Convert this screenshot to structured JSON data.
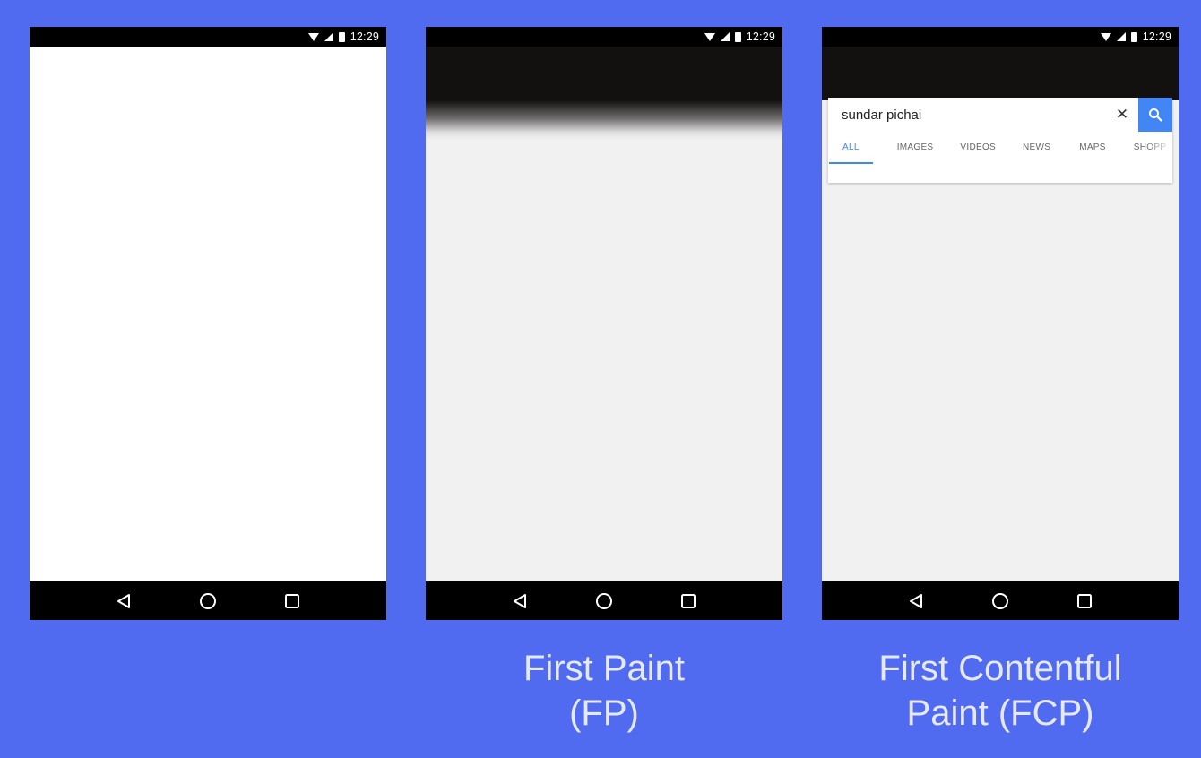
{
  "status_bar": {
    "time": "12:29"
  },
  "panels": [
    {
      "id": "blank"
    },
    {
      "id": "fp",
      "caption": {
        "line1": "First Paint",
        "line2": "(FP)"
      }
    },
    {
      "id": "fcp",
      "caption": {
        "line1": "First Contentful",
        "line2": "Paint (FCP)"
      },
      "search": {
        "value": "sundar pichai",
        "clear_icon": "close-icon",
        "button_icon": "search-icon"
      },
      "tabs": [
        "ALL",
        "IMAGES",
        "VIDEOS",
        "NEWS",
        "MAPS",
        "SHOPP"
      ],
      "active_tab": "ALL"
    }
  ],
  "nav_icons": [
    "back-icon",
    "home-icon",
    "recents-icon"
  ],
  "colors": {
    "background": "#516bf0",
    "accent": "#4285f4",
    "caption_text": "#e6e9fc",
    "page_gray": "#f1f1f1",
    "header_dark": "#131010"
  }
}
